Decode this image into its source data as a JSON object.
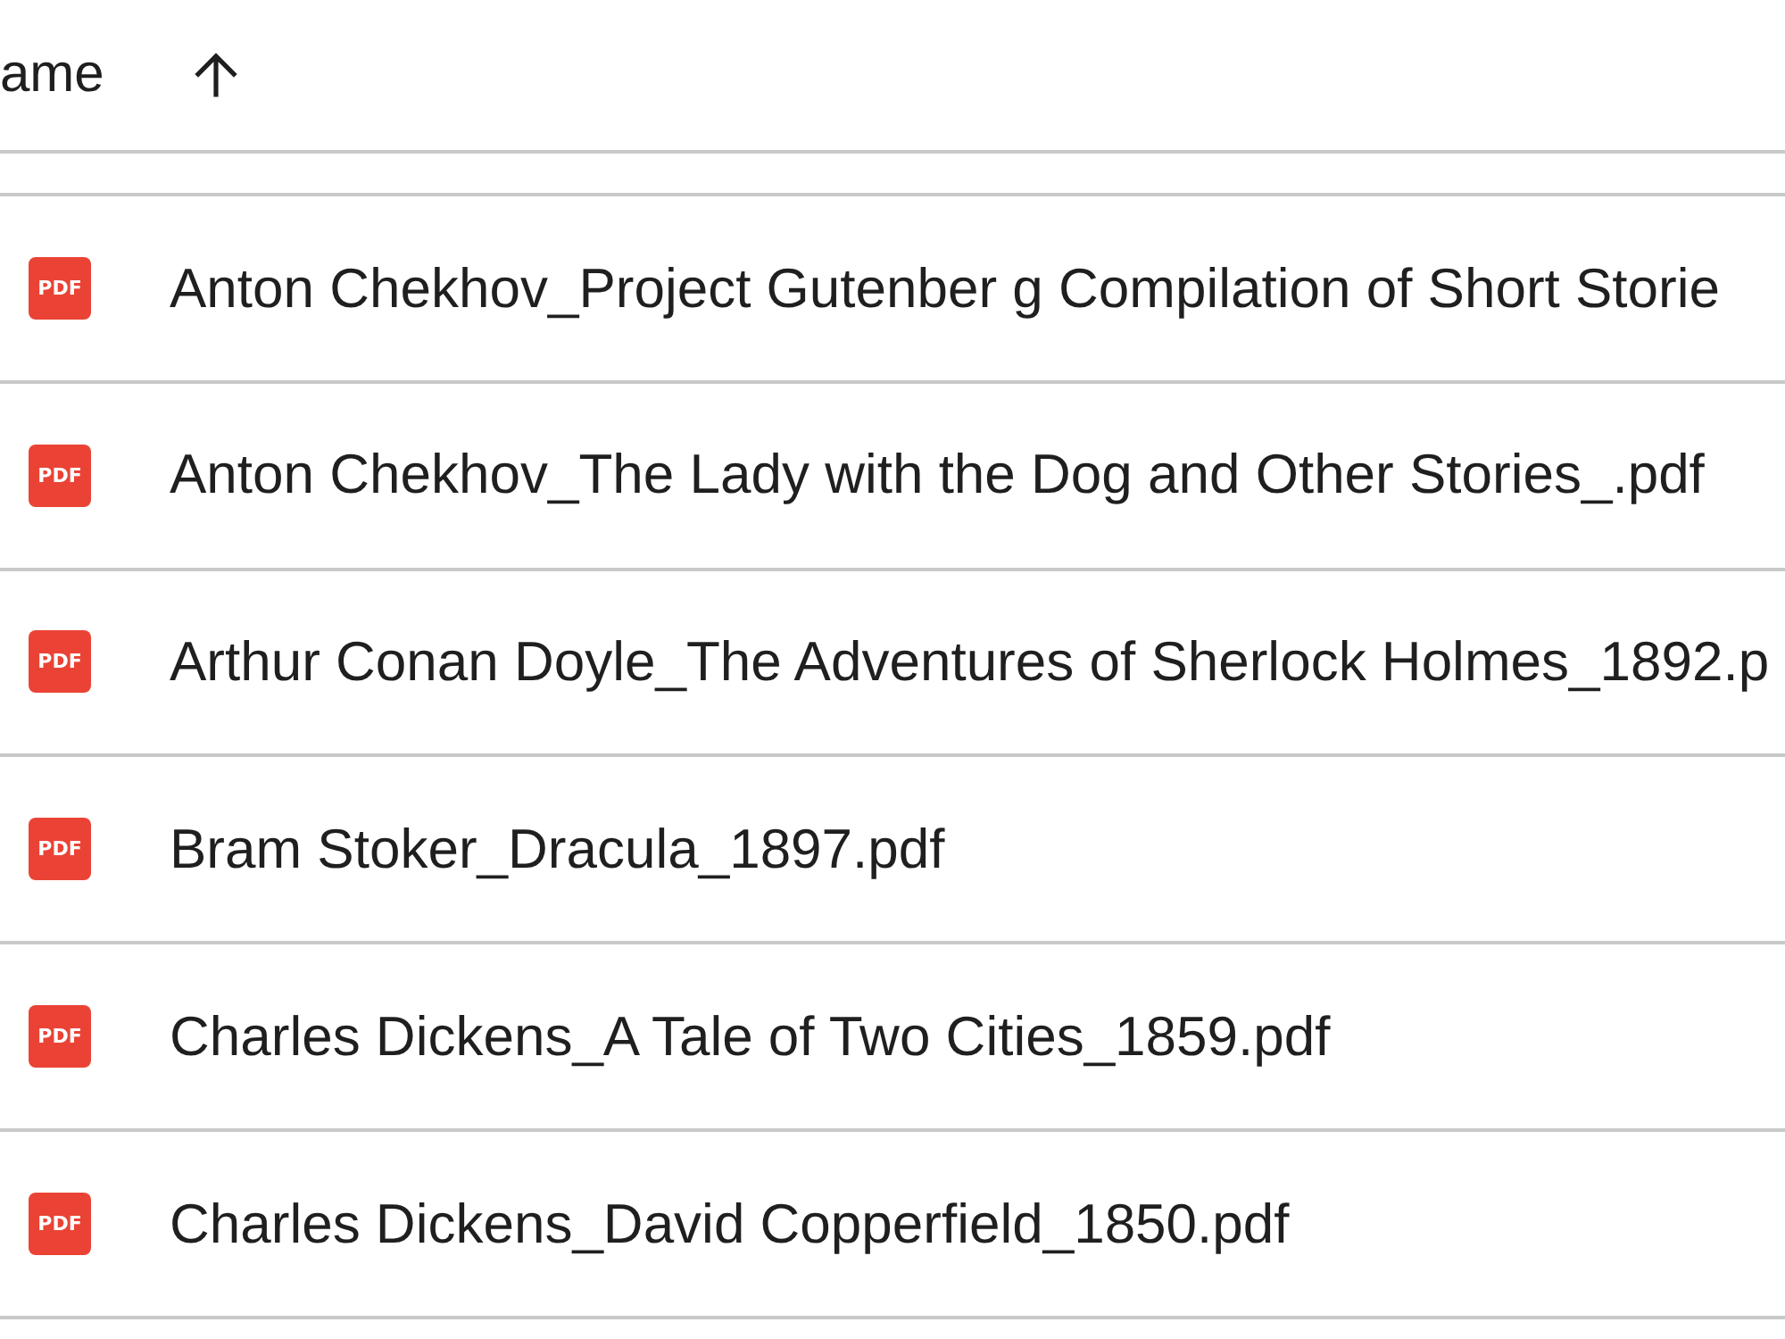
{
  "table": {
    "columns": [
      {
        "label": "ame",
        "sort_ascending": true
      }
    ],
    "rows": [
      {
        "file_type": "PDF",
        "name": "Anton Chekhov_Project Gutenber g Compilation of Short Storie"
      },
      {
        "file_type": "PDF",
        "name": "Anton Chekhov_The Lady with the Dog and Other Stories_.pdf"
      },
      {
        "file_type": "PDF",
        "name": "Arthur Conan Doyle_The Adventures of Sherlock Holmes_1892.p"
      },
      {
        "file_type": "PDF",
        "name": "Bram Stoker_Dracula_1897.pdf"
      },
      {
        "file_type": "PDF",
        "name": "Charles Dickens_A Tale of Two Cities_1859.pdf"
      },
      {
        "file_type": "PDF",
        "name": "Charles Dickens_David Copperfield_1850.pdf"
      }
    ]
  }
}
